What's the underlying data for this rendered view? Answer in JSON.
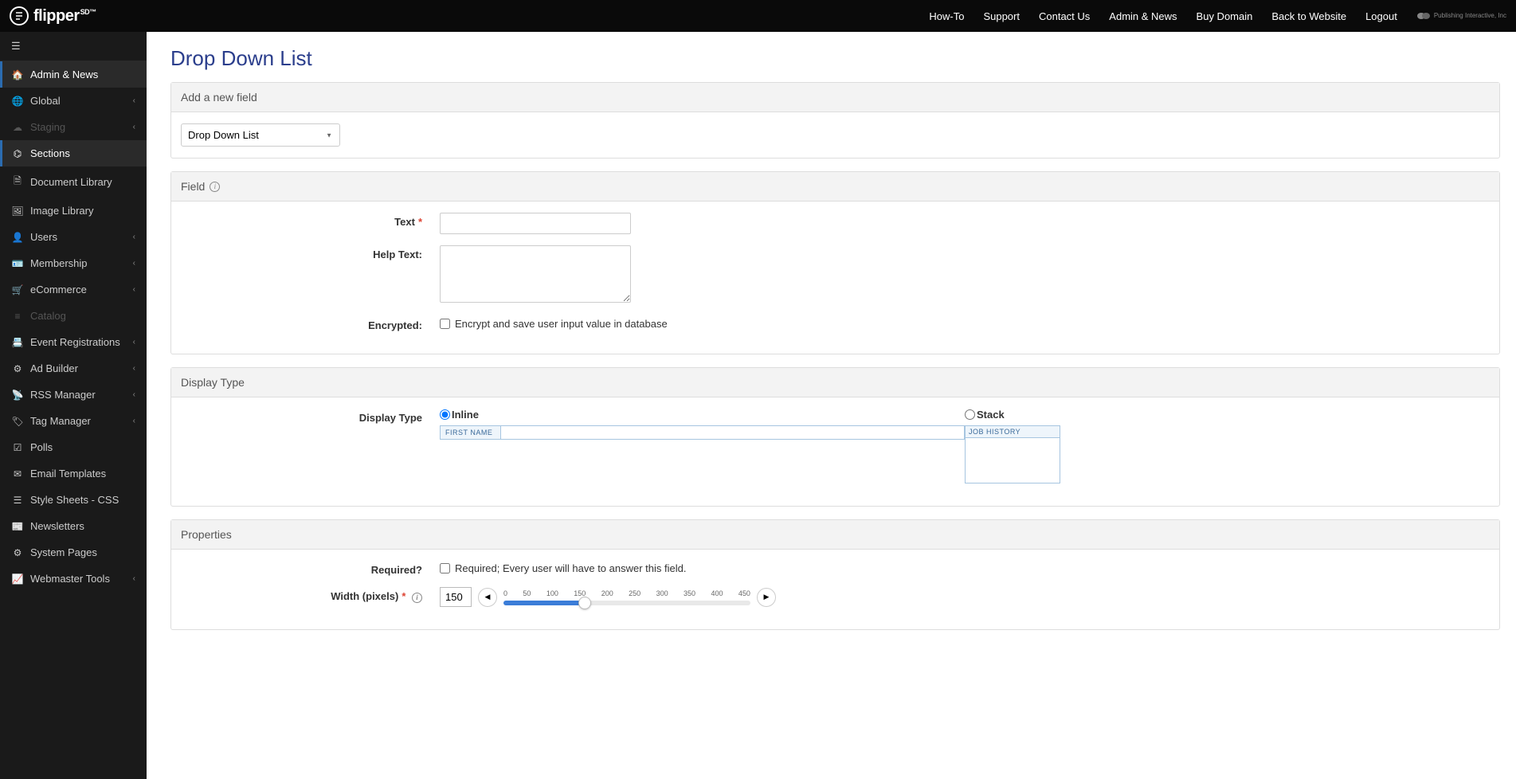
{
  "header": {
    "logo_text": "flipper",
    "logo_sup": "SD™",
    "nav": [
      "How-To",
      "Support",
      "Contact Us",
      "Admin & News",
      "Buy Domain",
      "Back to Website",
      "Logout"
    ],
    "company": "Publishing Interactive, Inc"
  },
  "sidebar": {
    "items": [
      {
        "icon": "home-icon",
        "glyph": "🏠",
        "label": "Admin & News",
        "active": true
      },
      {
        "icon": "globe-icon",
        "glyph": "🌐",
        "label": "Global",
        "chevron": true
      },
      {
        "icon": "cloud-icon",
        "glyph": "☁",
        "label": "Staging",
        "chevron": true,
        "disabled": true
      },
      {
        "icon": "layers-icon",
        "glyph": "⌬",
        "label": "Sections",
        "active": true
      },
      {
        "icon": "doc-icon",
        "glyph": "🗎",
        "label": "Document Library"
      },
      {
        "icon": "image-icon",
        "glyph": "🖼",
        "label": "Image Library"
      },
      {
        "icon": "user-icon",
        "glyph": "👤",
        "label": "Users",
        "chevron": true
      },
      {
        "icon": "card-icon",
        "glyph": "🪪",
        "label": "Membership",
        "chevron": true
      },
      {
        "icon": "cart-icon",
        "glyph": "🛒",
        "label": "eCommerce",
        "chevron": true
      },
      {
        "icon": "list-icon",
        "glyph": "≡",
        "label": "Catalog",
        "disabled": true
      },
      {
        "icon": "calendar-icon",
        "glyph": "📇",
        "label": "Event Registrations",
        "chevron": true
      },
      {
        "icon": "gears-icon",
        "glyph": "⚙",
        "label": "Ad Builder",
        "chevron": true
      },
      {
        "icon": "rss-icon",
        "glyph": "📡",
        "label": "RSS Manager",
        "chevron": true
      },
      {
        "icon": "tag-icon",
        "glyph": "🏷",
        "label": "Tag Manager",
        "chevron": true
      },
      {
        "icon": "check-icon",
        "glyph": "☑",
        "label": "Polls"
      },
      {
        "icon": "mail-icon",
        "glyph": "✉",
        "label": "Email Templates"
      },
      {
        "icon": "css-icon",
        "glyph": "☰",
        "label": "Style Sheets - CSS"
      },
      {
        "icon": "news-icon",
        "glyph": "📰",
        "label": "Newsletters"
      },
      {
        "icon": "cog-icon",
        "glyph": "⚙",
        "label": "System Pages"
      },
      {
        "icon": "chart-icon",
        "glyph": "📈",
        "label": "Webmaster Tools",
        "chevron": true
      }
    ]
  },
  "page": {
    "title": "Drop Down List",
    "add_field": {
      "header": "Add a new field",
      "select_value": "Drop Down List"
    },
    "field": {
      "header": "Field",
      "text_label": "Text",
      "help_text_label": "Help Text:",
      "encrypted_label": "Encrypted:",
      "encrypted_checkbox": "Encrypt and save user input value in database"
    },
    "display_type": {
      "header": "Display Type",
      "label": "Display Type",
      "inline_label": "Inline",
      "inline_preview_label": "FIRST NAME",
      "stack_label": "Stack",
      "stack_preview_label": "JOB HISTORY"
    },
    "properties": {
      "header": "Properties",
      "required_label": "Required?",
      "required_checkbox": "Required; Every user will have to answer this field.",
      "width_label": "Width (pixels)",
      "width_value": "150",
      "width_ticks": [
        "0",
        "50",
        "100",
        "150",
        "200",
        "250",
        "300",
        "350",
        "400",
        "450"
      ]
    }
  }
}
